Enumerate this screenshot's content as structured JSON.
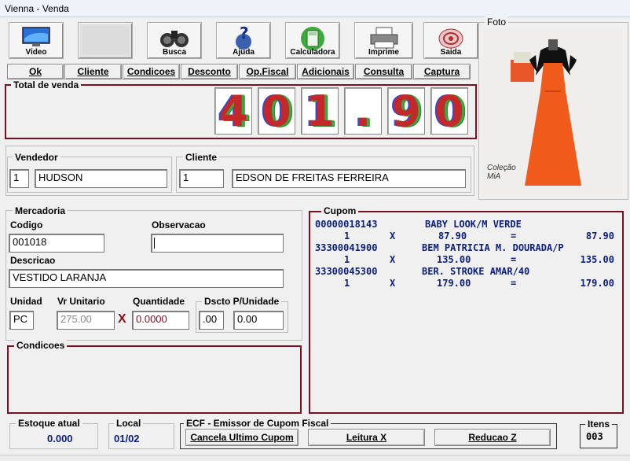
{
  "window": {
    "title": "Vienna - Venda"
  },
  "toolbar": [
    {
      "label": "Video",
      "icon": "monitor-icon"
    },
    {
      "label": "",
      "icon": "blank-icon"
    },
    {
      "label": "Busca",
      "icon": "binoculars-icon"
    },
    {
      "label": "Ajuda",
      "icon": "help-icon"
    },
    {
      "label": "Calculadora",
      "icon": "calculator-icon"
    },
    {
      "label": "Imprime",
      "icon": "printer-icon"
    },
    {
      "label": "Saida",
      "icon": "exit-icon"
    }
  ],
  "menu": [
    "Ok",
    "Cliente",
    "Condicoes",
    "Desconto",
    "Op.Fiscal",
    "Adicionais",
    "Consulta",
    "Captura"
  ],
  "total": {
    "label": "Total de venda",
    "digits": [
      "4",
      "0",
      "1",
      ".",
      "9",
      "0"
    ]
  },
  "vendedor": {
    "label": "Vendedor",
    "code": "1",
    "name": "HUDSON"
  },
  "cliente": {
    "label": "Cliente",
    "code": "1",
    "name": "EDSON DE FREITAS FERREIRA"
  },
  "foto": {
    "label": "Foto",
    "watermark": "Coleção MiA"
  },
  "mercadoria": {
    "label": "Mercadoria",
    "codigo_label": "Codigo",
    "codigo": "001018",
    "observacao_label": "Observacao",
    "observacao": "",
    "descricao_label": "Descricao",
    "descricao": "VESTIDO LARANJA",
    "unidad_label": "Unidad",
    "unidad": "PC",
    "vr_unitario_label": "Vr Unitario",
    "vr_unitario": "275.00",
    "quantidade_label": "Quantidade",
    "quantidade": "0.0000",
    "dscto_label": "Dscto P/Unidade",
    "dscto_pct": ".00",
    "dscto_val": "0.00",
    "times": "X"
  },
  "condicoes": {
    "label": "Condicoes"
  },
  "cupom": {
    "label": "Cupom",
    "items": [
      {
        "code": "00000018143",
        "desc": "BABY LOOK/M VERDE",
        "qty": "1",
        "x": "X",
        "unit": "87.90",
        "eq": "=",
        "total": "87.90"
      },
      {
        "code": "33300041900",
        "desc": "BEM PATRICIA M. DOURADA/P",
        "qty": "1",
        "x": "X",
        "unit": "135.00",
        "eq": "=",
        "total": "135.00"
      },
      {
        "code": "33300045300",
        "desc": "BER. STROKE AMAR/40",
        "qty": "1",
        "x": "X",
        "unit": "179.00",
        "eq": "=",
        "total": "179.00"
      }
    ]
  },
  "estoque": {
    "label": "Estoque atual",
    "value": "0.000"
  },
  "local": {
    "label": "Local",
    "value": "01/02"
  },
  "ecf": {
    "label": "ECF - Emissor de Cupom Fiscal",
    "buttons": [
      "Cancela Ultimo Cupom",
      "Leitura X",
      "Reducao Z"
    ]
  },
  "itens": {
    "label": "Itens",
    "value": "003"
  },
  "colors": {
    "accent_red": "#7a1020",
    "cupom_text": "#0b1f7a",
    "dress_orange": "#f05a1a"
  }
}
